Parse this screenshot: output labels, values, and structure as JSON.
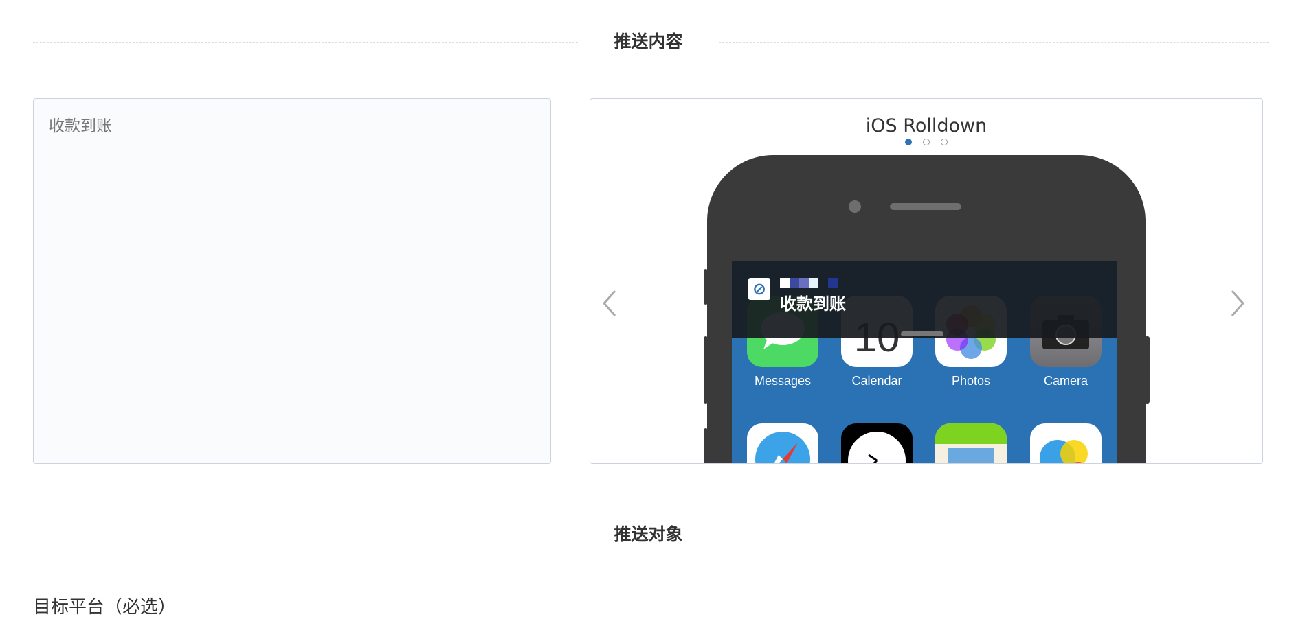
{
  "sections": {
    "content_title": "推送内容",
    "target_title": "推送对象"
  },
  "content": {
    "text": "收款到账"
  },
  "preview": {
    "title": "iOS Rolldown",
    "dots": [
      true,
      false,
      false
    ],
    "prev_icon": "chevron-left-icon",
    "next_icon": "chevron-right-icon",
    "notification": {
      "message": "收款到账",
      "app_icon": "app-logo-icon"
    },
    "apps": [
      {
        "label": "Messages",
        "icon": "messages-icon",
        "color": "#4cd964"
      },
      {
        "label": "Calendar",
        "icon": "calendar-icon",
        "color": "#ffffff",
        "day": "10"
      },
      {
        "label": "Photos",
        "icon": "photos-icon",
        "color": "#ffffff"
      },
      {
        "label": "Camera",
        "icon": "camera-icon",
        "color": "#8e8e93"
      },
      {
        "label": "",
        "icon": "safari-icon",
        "color": "#ffffff"
      },
      {
        "label": "",
        "icon": "clock-icon",
        "color": "#000000"
      },
      {
        "label": "",
        "icon": "maps-icon",
        "color": "#f5f0e0"
      },
      {
        "label": "",
        "icon": "game-center-icon",
        "color": "#ffffff"
      }
    ]
  },
  "target": {
    "platform_label": "目标平台（必选）"
  },
  "colors": {
    "accent": "#2f72b8",
    "screen_bg": "#2a72b3",
    "phone_body": "#3a3a3a"
  }
}
